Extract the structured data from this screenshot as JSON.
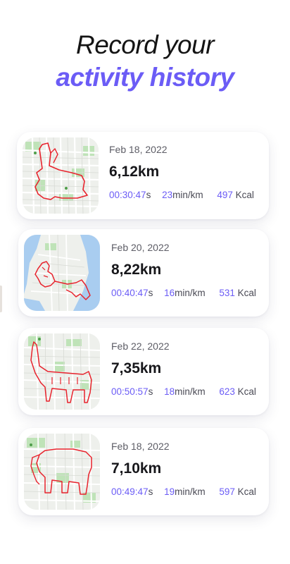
{
  "header": {
    "line1": "Record your",
    "line2": "activity history"
  },
  "colors": {
    "accent": "#6b5cf6",
    "route": "#e8232d",
    "map_park": "#bfe3b8",
    "map_water": "#a9cdf0",
    "map_land": "#eef0ec"
  },
  "activities": [
    {
      "date": "Feb 18, 2022",
      "distance": "6,12km",
      "time_value": "00:30:47",
      "time_unit": "s",
      "pace_value": "23",
      "pace_unit": "min/km",
      "kcal_value": "497",
      "kcal_unit": " Kcal",
      "map_icon": "rabbit-route-map"
    },
    {
      "date": "Feb 20, 2022",
      "distance": "8,22km",
      "time_value": "00:40:47",
      "time_unit": "s",
      "pace_value": "16",
      "pace_unit": "min/km",
      "kcal_value": "531",
      "kcal_unit": " Kcal",
      "map_icon": "lion-route-map"
    },
    {
      "date": "Feb 22, 2022",
      "distance": "7,35km",
      "time_value": "00:50:57",
      "time_unit": "s",
      "pace_value": "18",
      "pace_unit": "min/km",
      "kcal_value": "623",
      "kcal_unit": " Kcal",
      "map_icon": "giraffe-route-map"
    },
    {
      "date": "Feb 18, 2022",
      "distance": "7,10km",
      "time_value": "00:49:47",
      "time_unit": "s",
      "pace_value": "19",
      "pace_unit": "min/km",
      "kcal_value": "597",
      "kcal_unit": " Kcal",
      "map_icon": "elephant-route-map"
    }
  ]
}
